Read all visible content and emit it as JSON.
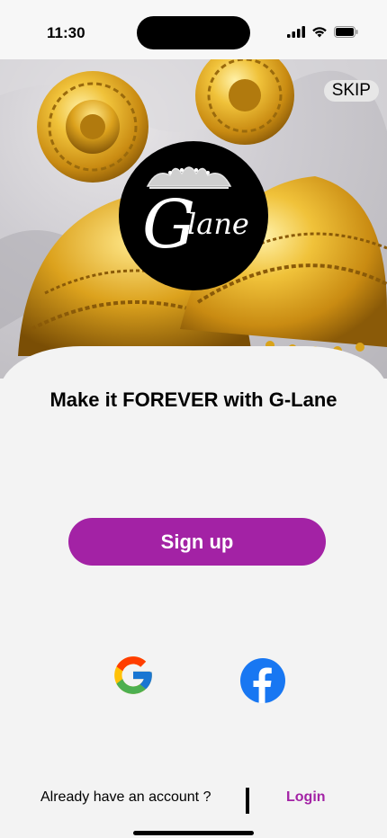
{
  "status": {
    "time": "11:30"
  },
  "hero": {
    "skip_label": "SKIP"
  },
  "logo": {
    "text": "Glane"
  },
  "headline": "Make it FOREVER with G-Lane",
  "signup": {
    "label": "Sign up"
  },
  "social": {
    "google_icon": "google-icon",
    "facebook_icon": "facebook-icon"
  },
  "footer": {
    "prompt": "Already have an account ?",
    "login_label": "Login"
  },
  "colors": {
    "accent": "#a322a5",
    "background": "#f3f3f3",
    "gold": "#d9a31a"
  }
}
